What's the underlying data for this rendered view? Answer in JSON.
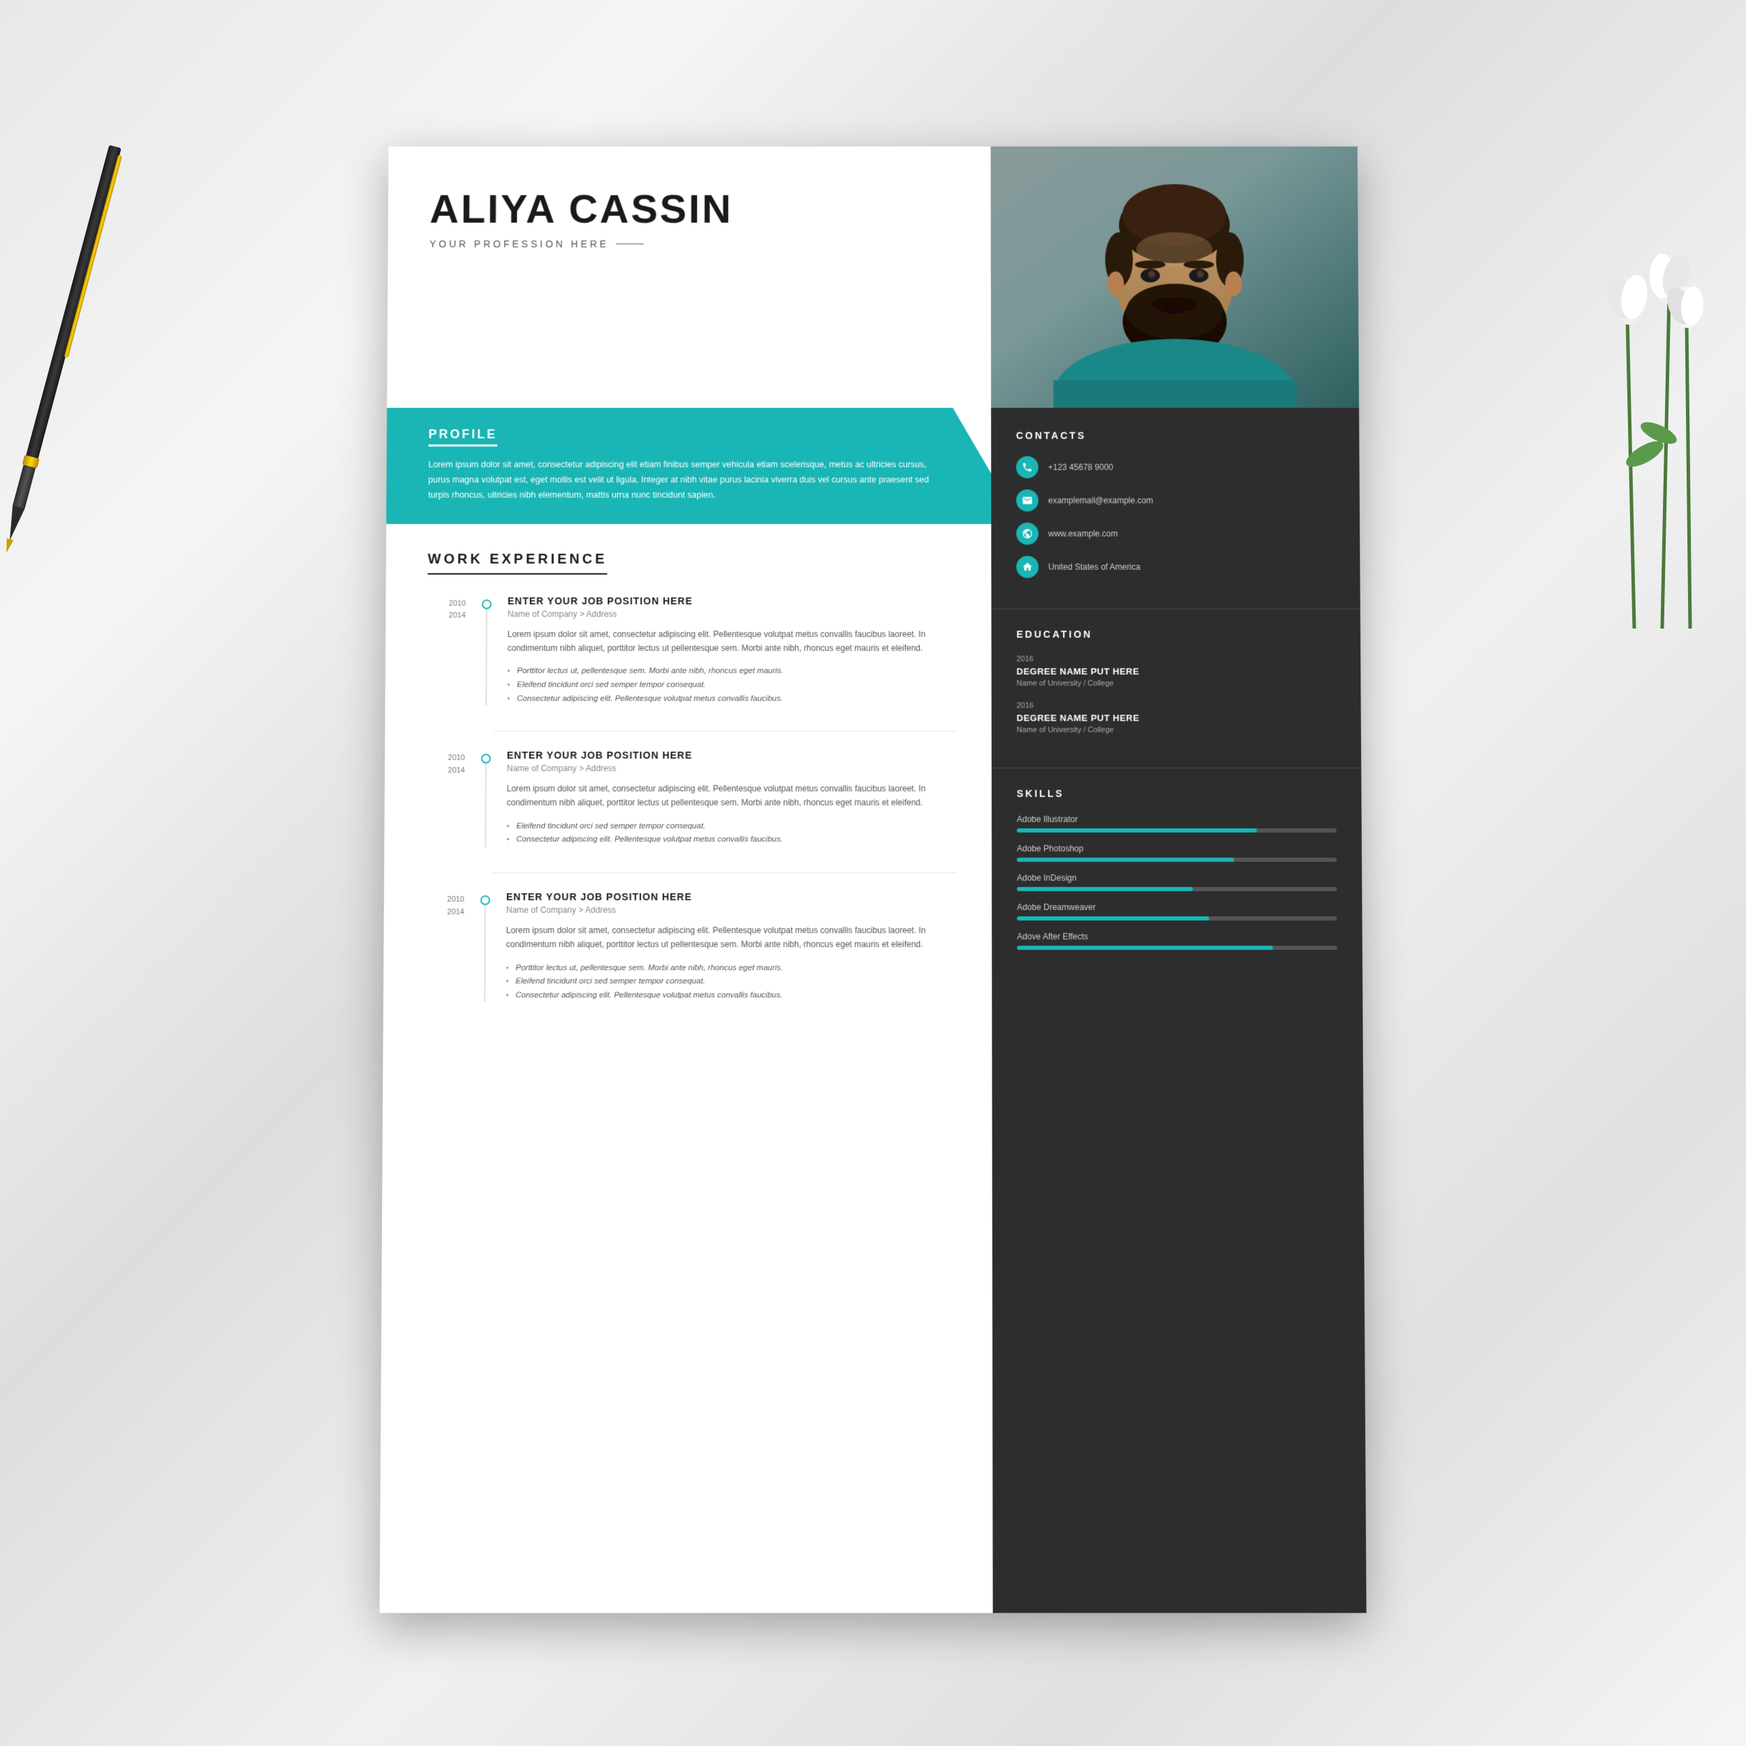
{
  "resume": {
    "name": "ALIYA CASSIN",
    "profession": "YOUR PROFESSION HERE",
    "profile": {
      "section_title": "PROFILE",
      "text": "Lorem ipsum dolor sit amet, consectetur adipiscing elit etiam finibus semper vehicula etiam scelerisque, metus ac ultricies cursus, purus magna volutpat est, eget mollis est velit ut ligula. Integer at nibh vitae purus lacinia viverra duis vel cursus ante praesent sed turpis rhoncus, ultricies nibh elementum, mattis urna nunc tincidunt sapien."
    },
    "work_experience": {
      "section_title": "WORK EXPERIENCE",
      "jobs": [
        {
          "year_start": "2010",
          "year_end": "2014",
          "title": "ENTER YOUR JOB POSITION HERE",
          "company": "Name of Company > Address",
          "description": "Lorem ipsum dolor sit amet, consectetur adipiscing elit. Pellentesque volutpat metus convallis faucibus laoreet. In condimentum nibh aliquet, porttitor lectus ut pellentesque sem. Morbi ante nibh, rhoncus eget mauris et eleifend.",
          "bullets": [
            "Porttitor lectus ut, pellentesque sem. Morbi ante nibh, rhoncus eget mauris.",
            "Eleifend tincidunt orci sed semper tempor consequat.",
            "Consectetur adipiscing elit. Pellentesque volutpat metus convallis faucibus."
          ]
        },
        {
          "year_start": "2010",
          "year_end": "2014",
          "title": "ENTER YOUR JOB POSITION HERE",
          "company": "Name of Company > Address",
          "description": "Lorem ipsum dolor sit amet, consectetur adipiscing elit. Pellentesque volutpat metus convallis faucibus laoreet. In condimentum nibh aliquet, porttitor lectus ut pellentesque sem. Morbi ante nibh, rhoncus eget mauris et eleifend.",
          "bullets": [
            "Eleifend tincidunt orci sed semper tempor consequat.",
            "Consectetur adipiscing elit. Pellentesque volutpat metus convallis faucibus."
          ]
        },
        {
          "year_start": "2010",
          "year_end": "2014",
          "title": "ENTER YOUR JOB POSITION HERE",
          "company": "Name of Company > Address",
          "description": "Lorem ipsum dolor sit amet, consectetur adipiscing elit. Pellentesque volutpat metus convallis faucibus laoreet. In condimentum nibh aliquet, porttitor lectus ut pellentesque sem. Morbi ante nibh, rhoncus eget mauris et eleifend.",
          "bullets": [
            "Porttitor lectus ut, pellentesque sem. Morbi ante nibh, rhoncus eget mauris.",
            "Eleifend tincidunt orci sed semper tempor consequat.",
            "Consectetur adipiscing elit. Pellentesque volutpat metus convallis faucibus."
          ]
        }
      ]
    },
    "contacts": {
      "section_title": "CONTACTS",
      "items": [
        {
          "icon": "📱",
          "text": "+123 45678 9000",
          "type": "phone"
        },
        {
          "icon": "✉",
          "text": "examplemail@example.com",
          "type": "email"
        },
        {
          "icon": "🌐",
          "text": "www.example.com",
          "type": "web"
        },
        {
          "icon": "🏠",
          "text": "United States of America",
          "type": "location"
        }
      ]
    },
    "education": {
      "section_title": "EDUCATION",
      "entries": [
        {
          "year": "2016",
          "degree": "DEGREE NAME PUT HERE",
          "school": "Name of University / College"
        },
        {
          "year": "2016",
          "degree": "DEGREE NAME PUT HERE",
          "school": "Name of University / College"
        }
      ]
    },
    "skills": {
      "section_title": "SKILLS",
      "items": [
        {
          "name": "Adobe Illustrator",
          "percent": 75
        },
        {
          "name": "Adobe Photoshop",
          "percent": 68
        },
        {
          "name": "Adobe InDesign",
          "percent": 55
        },
        {
          "name": "Adobe Dreamweaver",
          "percent": 60
        },
        {
          "name": "Adove After Effects",
          "percent": 80
        }
      ]
    }
  },
  "colors": {
    "teal": "#1ab5b5",
    "dark": "#2d2d2d",
    "white": "#ffffff"
  }
}
